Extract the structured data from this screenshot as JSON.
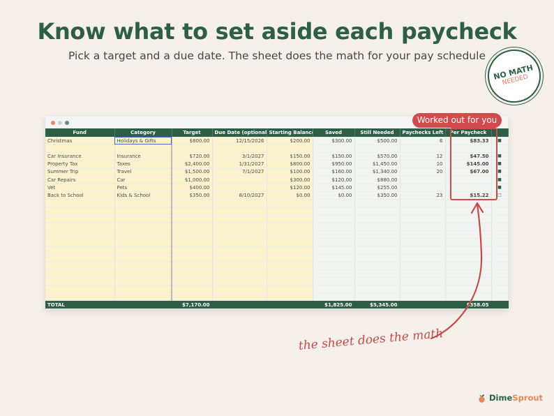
{
  "header": {
    "title": "Know what to set aside each paycheck",
    "subtitle": "Pick a target and a due date. The sheet does the math for your pay schedule"
  },
  "badge": {
    "line1": "NO MATH",
    "line2": "NEEDED"
  },
  "callout": {
    "label": "Worked out for you"
  },
  "annotation": {
    "text": "the sheet does the math"
  },
  "brand": {
    "part1": "Dime",
    "part2": "Sprout"
  },
  "colors": {
    "primary": "#2e5e45",
    "accent": "#d04c4c",
    "input_fill": "#fcf3cc",
    "output_fill": "#f1f4f1"
  },
  "sheet": {
    "columns": [
      "Fund",
      "Category",
      "Target",
      "Due Date (optional)",
      "Starting Balance",
      "Saved",
      "Still Needed",
      "Paychecks Left",
      "Per Paycheck"
    ],
    "rows": [
      {
        "fund": "Christmas",
        "category": "Holidays & Gifts",
        "target": "$800.00",
        "due": "12/15/2026",
        "start": "$200.00",
        "saved": "$300.00",
        "needed": "$500.00",
        "left": "6",
        "per": "$83.33",
        "marker": "■"
      },
      {
        "fund": "",
        "category": "",
        "target": "",
        "due": "",
        "start": "",
        "saved": "",
        "needed": "",
        "left": "",
        "per": "",
        "marker": ""
      },
      {
        "fund": "Car Insurance",
        "category": "Insurance",
        "target": "$720.00",
        "due": "3/1/2027",
        "start": "$150.00",
        "saved": "$150.00",
        "needed": "$570.00",
        "left": "12",
        "per": "$47.50",
        "marker": "■"
      },
      {
        "fund": "Property Tax",
        "category": "Taxes",
        "target": "$2,400.00",
        "due": "1/31/2027",
        "start": "$800.00",
        "saved": "$950.00",
        "needed": "$1,450.00",
        "left": "10",
        "per": "$145.00",
        "marker": "■"
      },
      {
        "fund": "Summer Trip",
        "category": "Travel",
        "target": "$1,500.00",
        "due": "7/1/2027",
        "start": "$100.00",
        "saved": "$160.00",
        "needed": "$1,340.00",
        "left": "20",
        "per": "$67.00",
        "marker": "■"
      },
      {
        "fund": "Car Repairs",
        "category": "Car",
        "target": "$1,000.00",
        "due": "",
        "start": "$300.00",
        "saved": "$120.00",
        "needed": "$880.00",
        "left": "",
        "per": "",
        "marker": "■"
      },
      {
        "fund": "Vet",
        "category": "Pets",
        "target": "$400.00",
        "due": "",
        "start": "$120.00",
        "saved": "$145.00",
        "needed": "$255.00",
        "left": "",
        "per": "",
        "marker": "■"
      },
      {
        "fund": "Back to School",
        "category": "Kids & School",
        "target": "$350.00",
        "due": "8/10/2027",
        "start": "$0.00",
        "saved": "$0.00",
        "needed": "$350.00",
        "left": "23",
        "per": "$15.22",
        "marker": "□"
      }
    ],
    "totals": {
      "label": "TOTAL",
      "target": "$7,170.00",
      "saved": "$1,825.00",
      "needed": "$5,345.00",
      "per": "$358.05"
    }
  }
}
